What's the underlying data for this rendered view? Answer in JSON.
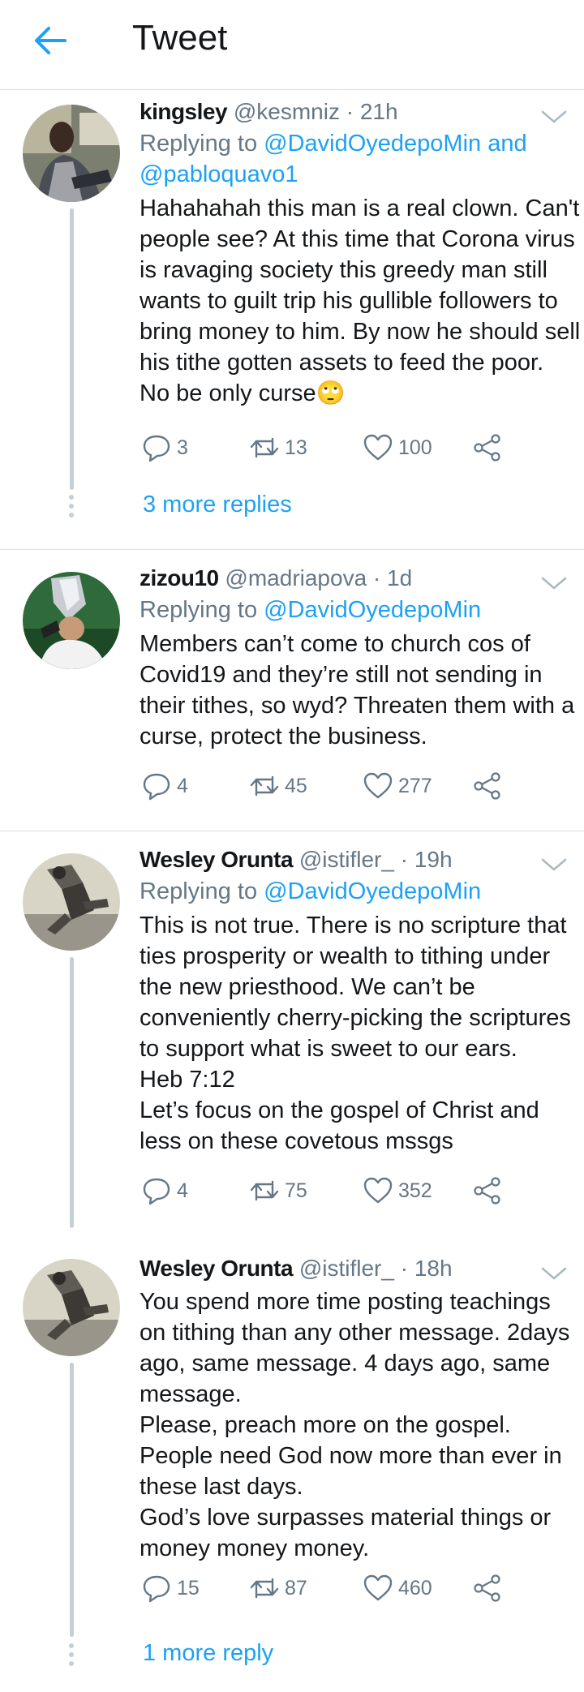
{
  "header": {
    "title": "Tweet"
  },
  "tweets": [
    {
      "name": "kingsley",
      "handle": "@kesmniz · 21h",
      "reply_prefix": "Replying to",
      "reply_line1_mention": "@DavidOyedepoMin",
      "reply_line1_suffix": " and",
      "reply_line2_mention": "@pabloquavo1",
      "lines": [
        "Hahahahah this man is a real clown. Can't",
        "people see? At this time that Corona virus",
        "is ravaging society this greedy man still",
        "wants to guilt trip his gullible followers to",
        "bring money to him. By now he should sell",
        "his tithe gotten assets to feed the poor.",
        "No be only curse🙄"
      ],
      "replies": "3",
      "retweets": "13",
      "likes": "100",
      "more_replies": "3 more replies"
    },
    {
      "name": "zizou10",
      "handle": "@madriapova · 1d",
      "reply_prefix": "Replying to",
      "reply_mention": "@DavidOyedepoMin",
      "lines": [
        "Members can’t come to church cos of",
        "Covid19 and they’re still not sending in",
        "their tithes, so wyd? Threaten them with a",
        "curse, protect the business."
      ],
      "replies": "4",
      "retweets": "45",
      "likes": "277"
    },
    {
      "name": "Wesley Orunta",
      "handle": "@istifler_ · 19h",
      "reply_prefix": "Replying to",
      "reply_mention": "@DavidOyedepoMin",
      "lines": [
        "This is not true. There is no scripture that",
        "ties prosperity or wealth to tithing under",
        "the new priesthood. We can’t be",
        "conveniently cherry-picking the scriptures",
        "to support what is sweet to our ears.",
        "Heb 7:12",
        "Let’s focus on the gospel of Christ and",
        "less on these covetous mssgs"
      ],
      "replies": "4",
      "retweets": "75",
      "likes": "352"
    },
    {
      "name": "Wesley Orunta",
      "handle": "@istifler_ · 18h",
      "lines": [
        "You spend more time posting teachings",
        "on tithing than any other message. 2days",
        "ago, same message. 4 days ago, same",
        "message.",
        "Please, preach more on the gospel.",
        "People need God now more than ever in",
        "these last days.",
        "God’s love surpasses material things or",
        "money money money."
      ],
      "replies": "15",
      "retweets": "87",
      "likes": "460",
      "more_replies": "1 more reply"
    }
  ]
}
